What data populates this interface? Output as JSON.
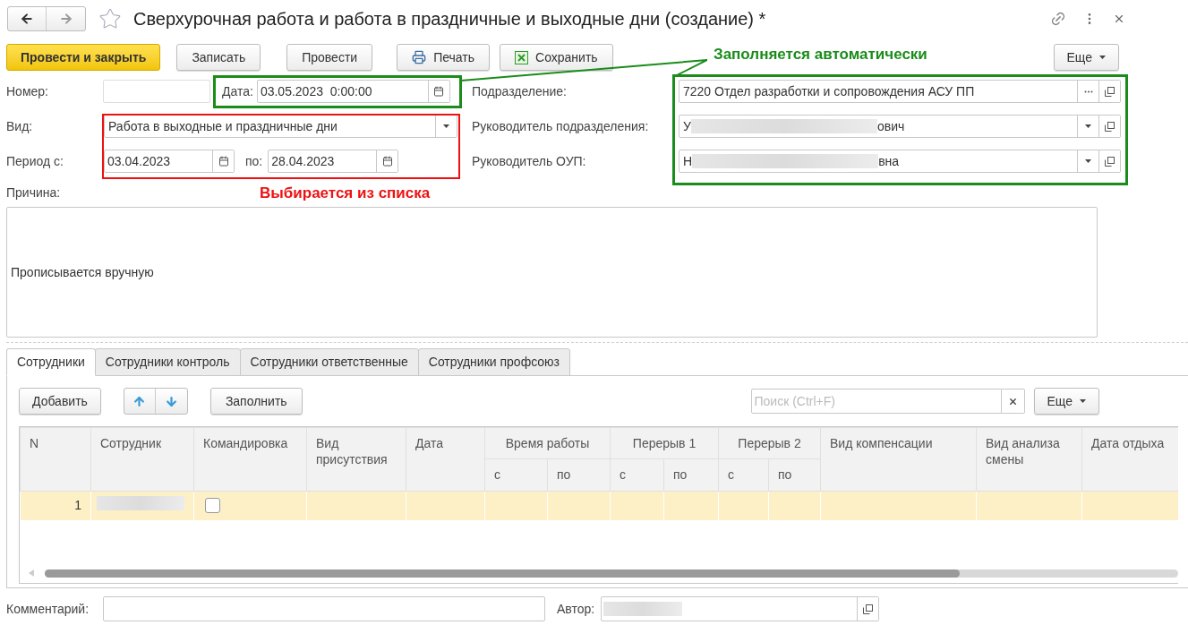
{
  "window": {
    "title": "Сверхурочная работа и работа в праздничные и выходные дни (создание) *"
  },
  "toolbar": [
    {
      "label": "Провести и закрыть",
      "kind": "primary"
    },
    {
      "label": "Записать",
      "kind": "plain"
    },
    {
      "label": "Провести",
      "kind": "plain"
    },
    {
      "label": "Печать",
      "kind": "print"
    },
    {
      "label": "Сохранить",
      "kind": "excel"
    }
  ],
  "toolbar_more": "Еще",
  "annotations": [
    {
      "text": "Заполняется автоматически",
      "color": "#1a8c1a"
    },
    {
      "text": "Выбирается из списка",
      "color": "#ee1111"
    }
  ],
  "number": {
    "label": "Номер:"
  },
  "date": {
    "label": "Дата:",
    "value": "03.05.2023  0:00:00"
  },
  "kind": {
    "label": "Вид:",
    "value": "Работа в выходные и праздничные дни"
  },
  "period": {
    "label": "Период с:",
    "from": "03.04.2023",
    "to_label": "по:",
    "to": "28.04.2023"
  },
  "department": {
    "label": "Подразделение:",
    "value": "7220 Отдел разработки и сопровождения АСУ ПП"
  },
  "department_head": {
    "label": "Руководитель подразделения:",
    "value_start": "У",
    "value_end": "ович",
    "redacted": true
  },
  "oup_head": {
    "label": "Руководитель ОУП:",
    "value_start": "Н",
    "value_end": "вна",
    "redacted": true
  },
  "reason": {
    "label": "Причина:",
    "value": "Прописывается вручную"
  },
  "tabs": [
    {
      "label": "Сотрудники",
      "selected": true
    },
    {
      "label": "Сотрудники контроль",
      "selected": false
    },
    {
      "label": "Сотрудники ответственные",
      "selected": false
    },
    {
      "label": "Сотрудники профсоюз",
      "selected": false
    }
  ],
  "table_toolbar": {
    "add": "Добавить",
    "fill": "Заполнить",
    "search_placeholder": "Поиск (Ctrl+F)",
    "more": "Еще"
  },
  "table": {
    "columns": [
      {
        "label": "N"
      },
      {
        "label": "Сотрудник"
      },
      {
        "label": "Командировка"
      },
      {
        "label": "Вид присутствия"
      },
      {
        "label": "Дата"
      },
      {
        "label": "Время работы",
        "sub": [
          "с",
          "по"
        ]
      },
      {
        "label": "Перерыв 1",
        "sub": [
          "с",
          "по"
        ]
      },
      {
        "label": "Перерыв 2",
        "sub": [
          "с",
          "по"
        ]
      },
      {
        "label": "Вид компенсации"
      },
      {
        "label": "Вид анализа смены"
      },
      {
        "label": "Дата отдыха"
      }
    ],
    "rows": [
      {
        "n": "1",
        "employee_redacted": true,
        "business_trip": false,
        "selected": true
      }
    ]
  },
  "comment": {
    "label": "Комментарий:"
  },
  "author": {
    "label": "Автор:",
    "redacted": true
  }
}
